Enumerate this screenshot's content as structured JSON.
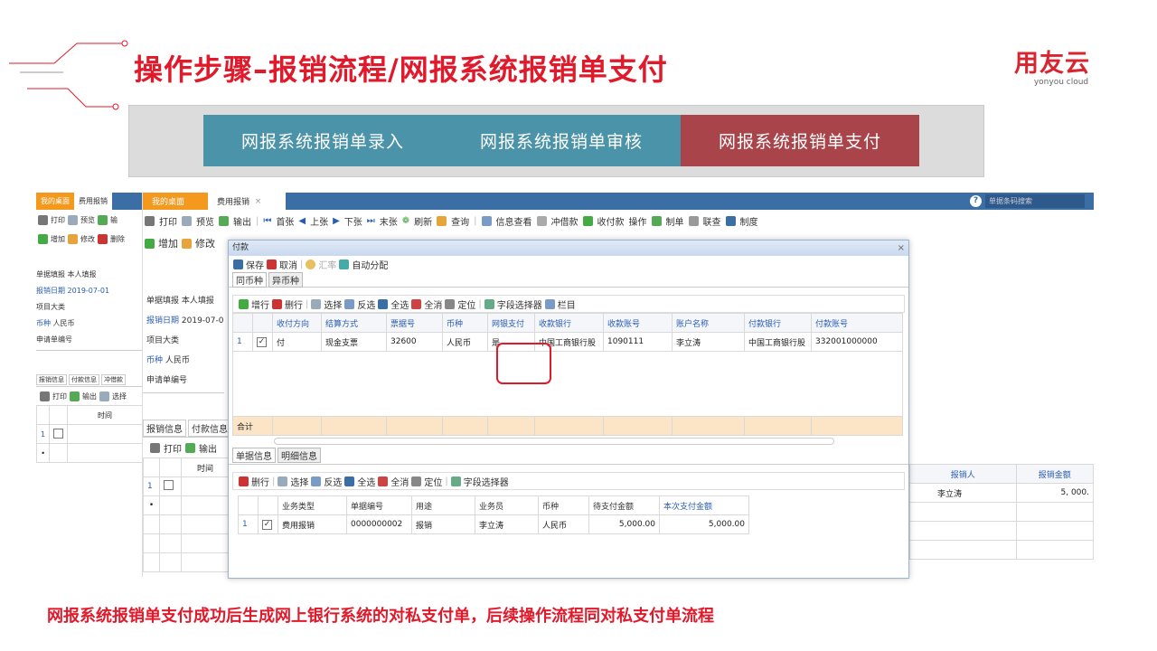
{
  "slide": {
    "title": "操作步骤–报销流程/网报系统报销单支付",
    "logo_cn": "用友云",
    "logo_en": "yonyou cloud",
    "steps": [
      "网报系统报销单录入",
      "网报系统报销单审核",
      "网报系统报销单支付"
    ],
    "caption": "网报系统报销单支付成功后生成网上银行系统的对私支付单，后续操作流程同对私支付单流程"
  },
  "colors": {
    "title_red": "#e0192b",
    "step_blue": "#4b93a8",
    "step_red": "#a8444a",
    "app_blue": "#3b6ea5",
    "tab_orange": "#f39a1e"
  },
  "app1": {
    "tabs": [
      "我的桌面",
      "费用报销"
    ],
    "toolbar1": [
      "打印",
      "预览",
      "输"
    ],
    "toolbar2": [
      "增加",
      "修改",
      "删除"
    ],
    "fields": [
      {
        "label": "单据填报",
        "value": "本人填报"
      },
      {
        "label": "报销日期",
        "value": "2019-07-01"
      },
      {
        "label": "项目大类",
        "value": ""
      },
      {
        "label": "币种",
        "value": "人民币"
      },
      {
        "label": "申请单编号",
        "value": ""
      }
    ],
    "subtabs": [
      "报销信息",
      "付款信息",
      "冲借款"
    ],
    "subtoolbar": [
      "打印",
      "输出",
      "选择"
    ],
    "col_time": "时间",
    "row_num": "1"
  },
  "app2": {
    "tabs": [
      "我的桌面",
      "费用报销"
    ],
    "tab_close": "×",
    "search_placeholder": "单据条码搜索",
    "help": "?",
    "toolbar1": [
      "打印",
      "预览",
      "输出",
      "首张",
      "上张",
      "下张",
      "末张",
      "刷新",
      "查询",
      "信息查看",
      "冲借款",
      "收付款",
      "操作",
      "制单",
      "联查",
      "制度"
    ],
    "toolbar2": [
      "增加",
      "修改"
    ],
    "fields": [
      {
        "label": "单据填报",
        "value": "本人填报"
      },
      {
        "label": "报销日期",
        "value": "2019-07-0"
      },
      {
        "label": "项目大类",
        "value": ""
      },
      {
        "label": "币种",
        "value": "人民币"
      },
      {
        "label": "申请单编号",
        "value": ""
      }
    ],
    "subtabs": [
      "报销信息",
      "付款信息"
    ],
    "subtoolbar": [
      "打印",
      "输出"
    ],
    "col_time": "时间",
    "row_num": "1",
    "right_cols": [
      "报销人",
      "报销金额"
    ],
    "right_row": {
      "person": "李立涛",
      "amount": "5, 000."
    }
  },
  "dialog": {
    "title": "付款",
    "close": "×",
    "toolbar": [
      "保存",
      "取消",
      "汇率",
      "自动分配"
    ],
    "currency_tabs": [
      "同币种",
      "异币种"
    ],
    "grid_toolbar": [
      "增行",
      "删行",
      "选择",
      "反选",
      "全选",
      "全消",
      "定位",
      "字段选择器",
      "栏目"
    ],
    "columns": [
      "收付方向",
      "结算方式",
      "票据号",
      "币种",
      "网银支付",
      "收款银行",
      "收款账号",
      "账户名称",
      "付款银行",
      "付款账号"
    ],
    "row": {
      "num": "1",
      "check": "✓",
      "cells": [
        "付",
        "现金支票",
        "32600",
        "人民币",
        "是",
        "中国工商银行股",
        "1090111",
        "李立涛",
        "中国工商银行股",
        "332001000000"
      ]
    },
    "total_label": "合计",
    "bottom_tabs": [
      "单据信息",
      "明细信息"
    ],
    "bottom_toolbar": [
      "删行",
      "选择",
      "反选",
      "全选",
      "全消",
      "定位",
      "字段选择器"
    ],
    "bottom_columns": [
      "业务类型",
      "单据编号",
      "用途",
      "业务员",
      "币种",
      "待支付金额",
      "本次支付金额"
    ],
    "bottom_row": {
      "num": "1",
      "check": "✓",
      "cells": [
        "费用报销",
        "0000000002",
        "报销",
        "李立涛",
        "人民币",
        "5,000.00",
        "5,000.00"
      ]
    }
  }
}
